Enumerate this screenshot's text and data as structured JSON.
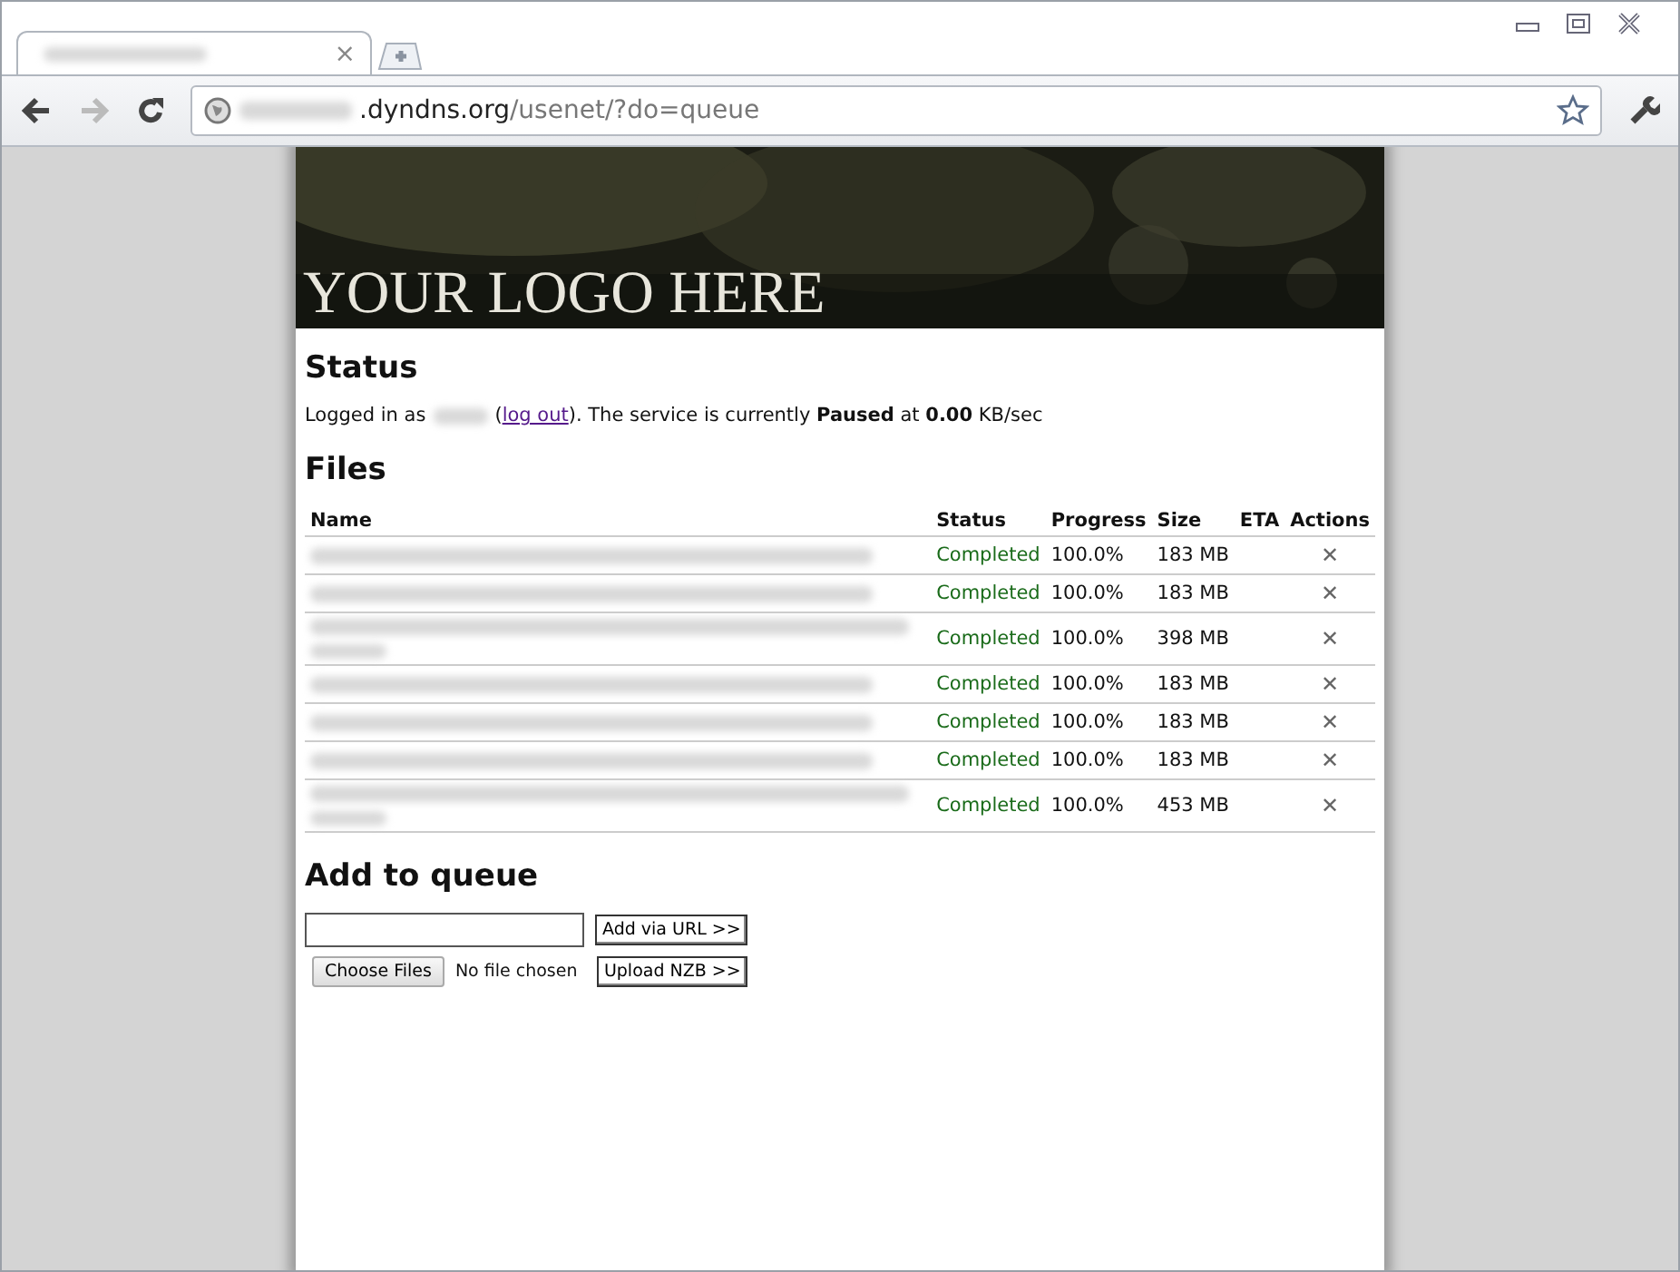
{
  "browser": {
    "tab": {
      "close": "×"
    },
    "address": {
      "host_visible": ".dyndns.org",
      "path": "/usenet/?do=queue"
    }
  },
  "banner": {
    "logo": "YOUR LOGO HERE"
  },
  "status": {
    "heading": "Status",
    "prefix": "Logged in as",
    "open": "(",
    "link": "log out",
    "rest": "). The service is currently **Paused** at **0.00** KB/sec"
  },
  "files": {
    "heading": "Files",
    "columns": [
      "Name",
      "Status",
      "Progress",
      "Size",
      "ETA",
      "Actions"
    ],
    "rows": [
      {
        "kind": "short",
        "status": "Completed",
        "progress": "100.0%",
        "size": "183 MB",
        "action": "✕"
      },
      {
        "kind": "short",
        "status": "Completed",
        "progress": "100.0%",
        "size": "183 MB",
        "action": "✕"
      },
      {
        "kind": "long",
        "status": "Completed",
        "progress": "100.0%",
        "size": "398 MB",
        "action": "✕"
      },
      {
        "kind": "short",
        "status": "Completed",
        "progress": "100.0%",
        "size": "183 MB",
        "action": "✕"
      },
      {
        "kind": "short",
        "status": "Completed",
        "progress": "100.0%",
        "size": "183 MB",
        "action": "✕"
      },
      {
        "kind": "short",
        "status": "Completed",
        "progress": "100.0%",
        "size": "183 MB",
        "action": "✕"
      },
      {
        "kind": "long",
        "status": "Completed",
        "progress": "100.0%",
        "size": "453 MB",
        "action": "✕"
      }
    ]
  },
  "queue": {
    "heading": "Add to queue",
    "url_button": "Add via URL >>",
    "choose_button": "Choose Files",
    "no_file": "No file chosen",
    "upload_button": "Upload NZB >>"
  }
}
